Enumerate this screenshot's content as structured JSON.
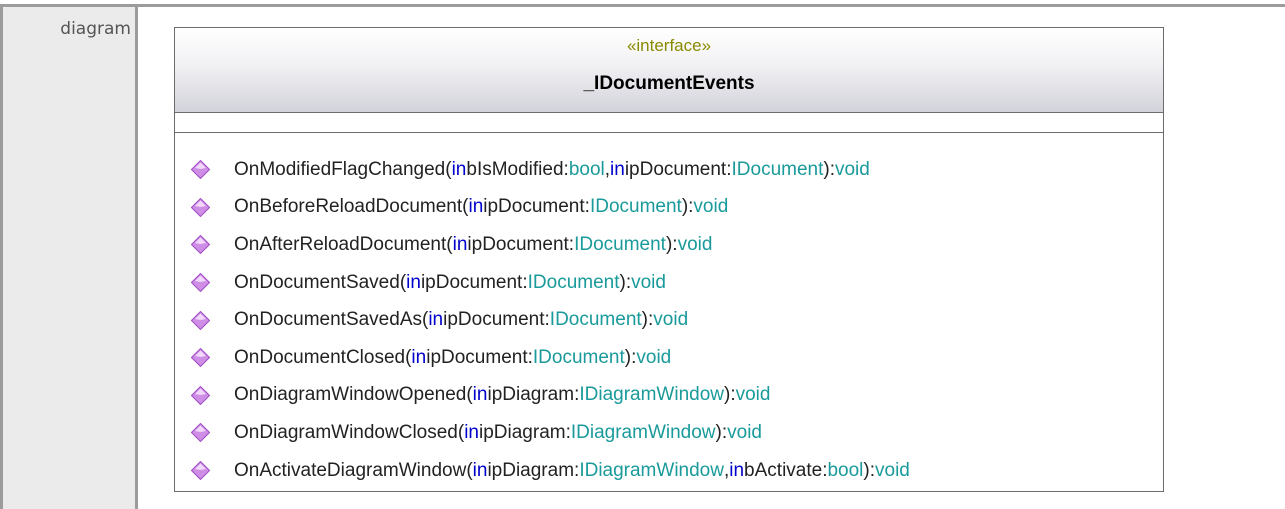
{
  "row_label": "diagram",
  "interface": {
    "stereotype": "«interface»",
    "name": "_IDocumentEvents"
  },
  "operations": [
    {
      "name": "OnModifiedFlagChanged",
      "params": [
        {
          "dir": "in",
          "name": "bIsModified",
          "type": "bool"
        },
        {
          "dir": "in",
          "name": "ipDocument",
          "type": "IDocument"
        }
      ],
      "return": "void"
    },
    {
      "name": "OnBeforeReloadDocument",
      "params": [
        {
          "dir": "in",
          "name": "ipDocument",
          "type": "IDocument"
        }
      ],
      "return": "void"
    },
    {
      "name": "OnAfterReloadDocument",
      "params": [
        {
          "dir": "in",
          "name": "ipDocument",
          "type": "IDocument"
        }
      ],
      "return": "void"
    },
    {
      "name": "OnDocumentSaved",
      "params": [
        {
          "dir": "in",
          "name": "ipDocument",
          "type": "IDocument"
        }
      ],
      "return": "void"
    },
    {
      "name": "OnDocumentSavedAs",
      "params": [
        {
          "dir": "in",
          "name": "ipDocument",
          "type": "IDocument"
        }
      ],
      "return": "void"
    },
    {
      "name": "OnDocumentClosed",
      "params": [
        {
          "dir": "in",
          "name": "ipDocument",
          "type": "IDocument"
        }
      ],
      "return": "void"
    },
    {
      "name": "OnDiagramWindowOpened",
      "params": [
        {
          "dir": "in",
          "name": "ipDiagram",
          "type": "IDiagramWindow"
        }
      ],
      "return": "void"
    },
    {
      "name": "OnDiagramWindowClosed",
      "params": [
        {
          "dir": "in",
          "name": "ipDiagram",
          "type": "IDiagramWindow"
        }
      ],
      "return": "void"
    },
    {
      "name": "OnActivateDiagramWindow",
      "params": [
        {
          "dir": "in",
          "name": "ipDiagram",
          "type": "IDiagramWindow"
        },
        {
          "dir": "in",
          "name": "bActivate",
          "type": "bool"
        }
      ],
      "return": "void"
    }
  ],
  "icon": "operation-diamond-icon",
  "colors": {
    "keyword": "#0000cc",
    "type": "#1a9a9a",
    "stereotype": "#8a8a00",
    "diamond": "#cf8ee6"
  }
}
